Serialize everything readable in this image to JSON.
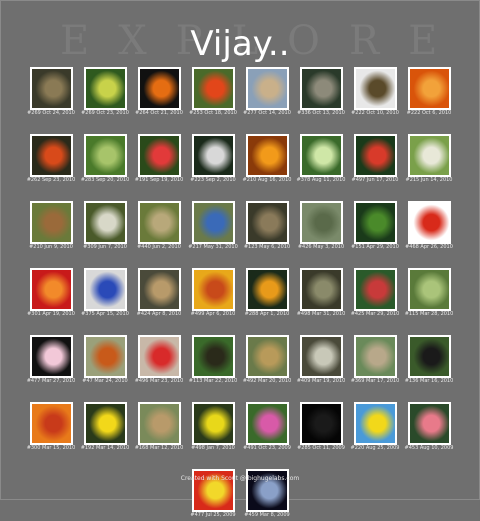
{
  "header": {
    "watermark": "EXPLORE",
    "title": "Vijay.."
  },
  "photos": [
    {
      "caption": "#269 Oct 24, 2010",
      "colors": [
        "#3a3a2a",
        "#8a7a55"
      ]
    },
    {
      "caption": "#269 Oct 23, 2010",
      "colors": [
        "#2f5a1f",
        "#c8d24a"
      ]
    },
    {
      "caption": "#264 Oct 21, 2010",
      "colors": [
        "#111",
        "#e56d12"
      ]
    },
    {
      "caption": "#253 Oct 18, 2010",
      "colors": [
        "#4a6a2a",
        "#e2461a"
      ]
    },
    {
      "caption": "#277 Oct 14, 2010",
      "colors": [
        "#8aa0b8",
        "#c9b08a"
      ]
    },
    {
      "caption": "#336 Oct 13, 2010",
      "colors": [
        "#2a3a2a",
        "#8d8a7a"
      ]
    },
    {
      "caption": "#222 Oct 10, 2010",
      "colors": [
        "#e8e8e8",
        "#5a4a2a"
      ]
    },
    {
      "caption": "#222 Oct 6, 2010",
      "colors": [
        "#d9540a",
        "#f2a23a"
      ]
    },
    {
      "caption": "#262 Sep 23, 2010",
      "colors": [
        "#2a2a1a",
        "#d84a1a"
      ]
    },
    {
      "caption": "#283 Sep 20, 2010",
      "colors": [
        "#4a7a2a",
        "#a7c46a"
      ]
    },
    {
      "caption": "#191 Sep 19, 2010",
      "colors": [
        "#2a4a1a",
        "#e23a3a"
      ]
    },
    {
      "caption": "#223 Sep 2, 2010",
      "colors": [
        "#1a2a1a",
        "#d8d8d8"
      ]
    },
    {
      "caption": "#210 Aug 16, 2010",
      "colors": [
        "#8a3a0a",
        "#f29a1a"
      ]
    },
    {
      "caption": "#378 Aug 11, 2010",
      "colors": [
        "#3a6a2a",
        "#cfe7a7"
      ]
    },
    {
      "caption": "#497 Jun 17, 2010",
      "colors": [
        "#1a3a1a",
        "#d83a2a"
      ]
    },
    {
      "caption": "#215 Jun 14, 2010",
      "colors": [
        "#7aa04a",
        "#e8e8d8"
      ]
    },
    {
      "caption": "#210 Jun 9, 2010",
      "colors": [
        "#6a7a3a",
        "#9a6a3a"
      ]
    },
    {
      "caption": "#309 Jun 7, 2010",
      "colors": [
        "#4a5a2a",
        "#d8d8c8"
      ]
    },
    {
      "caption": "#440 Jun 2, 2010",
      "colors": [
        "#6a7a3a",
        "#b8a87a"
      ]
    },
    {
      "caption": "#217 May 31, 2010",
      "colors": [
        "#6a7a4a",
        "#3a6ab8"
      ]
    },
    {
      "caption": "#123 May 6, 2010",
      "colors": [
        "#3a3a2a",
        "#8a7a5a"
      ]
    },
    {
      "caption": "#426 May 3, 2010",
      "colors": [
        "#7a8a6a",
        "#5a6a4a"
      ]
    },
    {
      "caption": "#151 Apr 29, 2010",
      "colors": [
        "#1a3a1a",
        "#4a8a2a"
      ]
    },
    {
      "caption": "#468 Apr 26, 2010",
      "colors": [
        "#ffffff",
        "#d82a1a"
      ]
    },
    {
      "caption": "#301 Apr 19, 2010",
      "colors": [
        "#c81a1a",
        "#f28a2a"
      ]
    },
    {
      "caption": "#375 Apr 15, 2010",
      "colors": [
        "#d8d8d8",
        "#2a4ab8"
      ]
    },
    {
      "caption": "#424 Apr 8, 2010",
      "colors": [
        "#4a4a3a",
        "#b89a6a"
      ]
    },
    {
      "caption": "#499 Apr 6, 2010",
      "colors": [
        "#e8a81a",
        "#c84a1a"
      ]
    },
    {
      "caption": "#288 Apr 1, 2010",
      "colors": [
        "#1a2a1a",
        "#e89a1a"
      ]
    },
    {
      "caption": "#498 Mar 31, 2010",
      "colors": [
        "#3a3a2a",
        "#8a8a6a"
      ]
    },
    {
      "caption": "#425 Mar 29, 2010",
      "colors": [
        "#2a5a2a",
        "#c83a3a"
      ]
    },
    {
      "caption": "#115 Mar 28, 2010",
      "colors": [
        "#5a7a3a",
        "#aac47a"
      ]
    },
    {
      "caption": "#477 Mar 27, 2010",
      "colors": [
        "#111111",
        "#f2c8d8"
      ]
    },
    {
      "caption": "#47 Mar 24, 2010",
      "colors": [
        "#9aa07a",
        "#c85a1a"
      ]
    },
    {
      "caption": "#496 Mar 23, 2010",
      "colors": [
        "#c8b8a8",
        "#d82a2a"
      ]
    },
    {
      "caption": "#113 Mar 22, 2010",
      "colors": [
        "#3a6a2a",
        "#2a2a1a"
      ]
    },
    {
      "caption": "#492 Mar 20, 2010",
      "colors": [
        "#6a7a4a",
        "#b89a5a"
      ]
    },
    {
      "caption": "#409 Mar 19, 2010",
      "colors": [
        "#4a4a3a",
        "#c8c8b8"
      ]
    },
    {
      "caption": "#369 Mar 17, 2010",
      "colors": [
        "#6a8a5a",
        "#b8a88a"
      ]
    },
    {
      "caption": "#136 Mar 16, 2010",
      "colors": [
        "#3a5a2a",
        "#1a1a1a"
      ]
    },
    {
      "caption": "#300 Mar 15, 2010",
      "colors": [
        "#e87a1a",
        "#c83a1a"
      ]
    },
    {
      "caption": "#192 Mar 14, 2010",
      "colors": [
        "#2a3a1a",
        "#f2d81a"
      ]
    },
    {
      "caption": "#168 Mar 12, 2010",
      "colors": [
        "#7a8a5a",
        "#b89a6a"
      ]
    },
    {
      "caption": "#498 Jan 7, 2010",
      "colors": [
        "#2a3a1a",
        "#e8d81a"
      ]
    },
    {
      "caption": "#491 Oct 23, 2009",
      "colors": [
        "#3a6a2a",
        "#d85aa8"
      ]
    },
    {
      "caption": "#285 Oct 11, 2009",
      "colors": [
        "#050505",
        "#1a1a1a"
      ]
    },
    {
      "caption": "#220 Aug 25, 2009",
      "colors": [
        "#4a9ad8",
        "#f2d81a"
      ]
    },
    {
      "caption": "#453 Aug 10, 2009",
      "colors": [
        "#2a4a2a",
        "#e87a8a"
      ]
    },
    {
      "caption": "#477 Jul 25, 2009",
      "colors": [
        "#d82a1a",
        "#f2d82a"
      ]
    },
    {
      "caption": "#459 Mar 8, 2009",
      "colors": [
        "#0a0a1a",
        "#8aa0c8"
      ]
    }
  ],
  "footer": {
    "text": "Created with Scout @ bighugelabs.com"
  }
}
